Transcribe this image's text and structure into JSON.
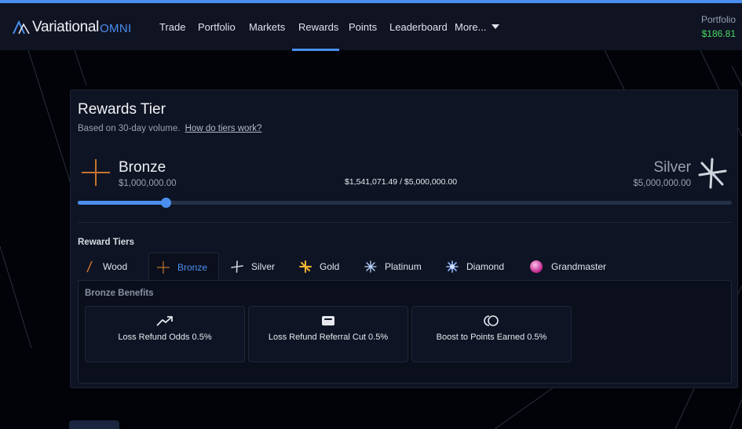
{
  "nav": {
    "logo_main": "Variational",
    "logo_sub": "OMNI",
    "items": [
      "Trade",
      "Portfolio",
      "Markets",
      "Rewards",
      "Points",
      "Leaderboard",
      "More..."
    ],
    "active": "Rewards",
    "portfolio_label": "Portfolio",
    "portfolio_value": "$186.81"
  },
  "rewards": {
    "title": "Rewards Tier",
    "subtitle": "Based on 30-day volume.",
    "subtitle_link": "How do tiers work?",
    "current_tier": {
      "name": "Bronze",
      "volume": "$1,000,000.00",
      "icon": "bronze-cross-icon"
    },
    "next_tier": {
      "name": "Silver",
      "volume": "$5,000,000.00",
      "icon": "silver-star-icon"
    },
    "progress_text": "$1,541,071.49 / $5,000,000.00",
    "progress_fraction": 0.135
  },
  "reward_tiers": {
    "label": "Reward Tiers",
    "tabs": [
      {
        "label": "Wood",
        "icon": "wood-slash-icon"
      },
      {
        "label": "Bronze",
        "icon": "bronze-cross-icon"
      },
      {
        "label": "Silver",
        "icon": "silver-star-icon"
      },
      {
        "label": "Gold",
        "icon": "gold-star-icon"
      },
      {
        "label": "Platinum",
        "icon": "platinum-burst-icon"
      },
      {
        "label": "Diamond",
        "icon": "diamond-burst-icon"
      },
      {
        "label": "Grandmaster",
        "icon": "grandmaster-orb-icon"
      }
    ],
    "active_tab": "Bronze"
  },
  "benefits": {
    "title": "Bronze Benefits",
    "cards": [
      {
        "label": "Loss Refund Odds 0.5%",
        "icon": "trending-up-icon"
      },
      {
        "label": "Loss Refund Referral Cut 0.5%",
        "icon": "wallet-icon"
      },
      {
        "label": "Boost to Points Earned 0.5%",
        "icon": "points-coin-icon"
      }
    ]
  },
  "colors": {
    "accent": "#4a8ef0",
    "positive": "#4cd964",
    "bronze": "#c4742f",
    "gold": "#f0b232",
    "grandmaster": "#e24ab6"
  }
}
